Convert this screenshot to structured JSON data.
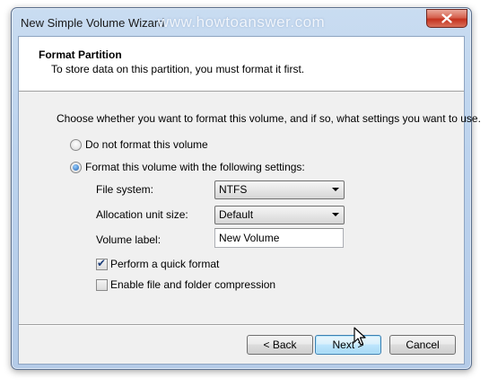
{
  "window": {
    "title": "New Simple Volume Wizard",
    "watermark": "www.howtoanswer.com"
  },
  "header": {
    "title": "Format Partition",
    "subtitle": "To store data on this partition, you must format it first."
  },
  "body": {
    "instruction": "Choose whether you want to format this volume, and if so, what settings you want to use.",
    "options": [
      {
        "label": "Do not format this volume",
        "selected": false
      },
      {
        "label": "Format this volume with the following settings:",
        "selected": true
      }
    ],
    "settings": {
      "file_system_label": "File system:",
      "file_system_value": "NTFS",
      "alloc_label": "Allocation unit size:",
      "alloc_value": "Default",
      "volume_label_label": "Volume label:",
      "volume_label_value": "New Volume"
    },
    "checkboxes": [
      {
        "label": "Perform a quick format",
        "checked": true
      },
      {
        "label": "Enable file and folder compression",
        "checked": false
      }
    ]
  },
  "footer": {
    "back_label": "< Back",
    "next_label": "Next >",
    "cancel_label": "Cancel"
  },
  "colors": {
    "title_bar": "#bcd3ee",
    "close_button": "#c4321f",
    "default_button": "#bee6fd"
  }
}
